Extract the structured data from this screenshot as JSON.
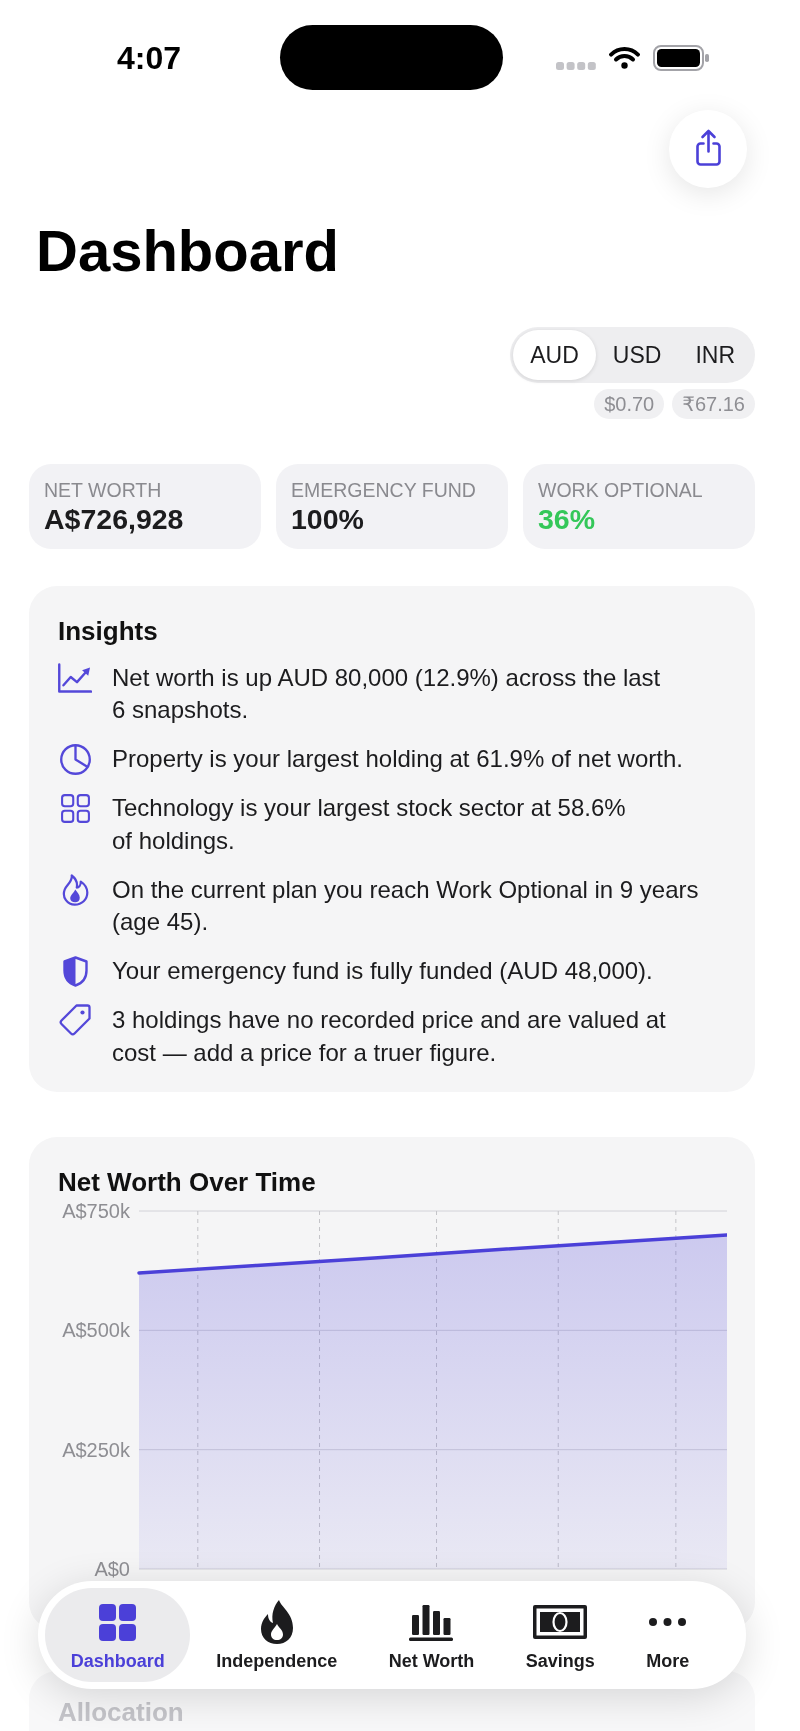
{
  "status_bar": {
    "time": "4:07"
  },
  "title": "Dashboard",
  "currency": {
    "options": [
      {
        "label": "AUD",
        "selected": true
      },
      {
        "label": "USD",
        "selected": false
      },
      {
        "label": "INR",
        "selected": false
      }
    ],
    "rates": [
      "$0.70",
      "₹67.16"
    ]
  },
  "stats": [
    {
      "label": "NET WORTH",
      "value": "A$726,928",
      "color": "#1c1c1e"
    },
    {
      "label": "EMERGENCY FUND",
      "value": "100%",
      "color": "#1c1c1e"
    },
    {
      "label": "WORK OPTIONAL",
      "value": "36%",
      "color": "#34c759"
    }
  ],
  "insights": {
    "title": "Insights",
    "items": [
      "Net worth is up AUD 80,000 (12.9%) across the last 6 snapshots.",
      "Property is your largest holding at 61.9% of net worth.",
      "Technology is your largest stock sector at 58.6% of holdings.",
      "On the current plan you reach Work Optional in 9 years (age 45).",
      "Your emergency fund is fully funded (AUD 48,000).",
      "3 holdings have no recorded price and are valued at cost — add a price for a truer figure."
    ]
  },
  "net_worth_chart": {
    "title": "Net Worth Over Time",
    "y_axis_labels": [
      "A$750k",
      "A$500k",
      "A$250k",
      "A$0"
    ]
  },
  "allocation": {
    "title": "Allocation"
  },
  "tab_bar": [
    {
      "label": "Dashboard",
      "selected": true
    },
    {
      "label": "Independence",
      "selected": false
    },
    {
      "label": "Net Worth",
      "selected": false
    },
    {
      "label": "Savings",
      "selected": false
    },
    {
      "label": "More",
      "selected": false
    }
  ]
}
